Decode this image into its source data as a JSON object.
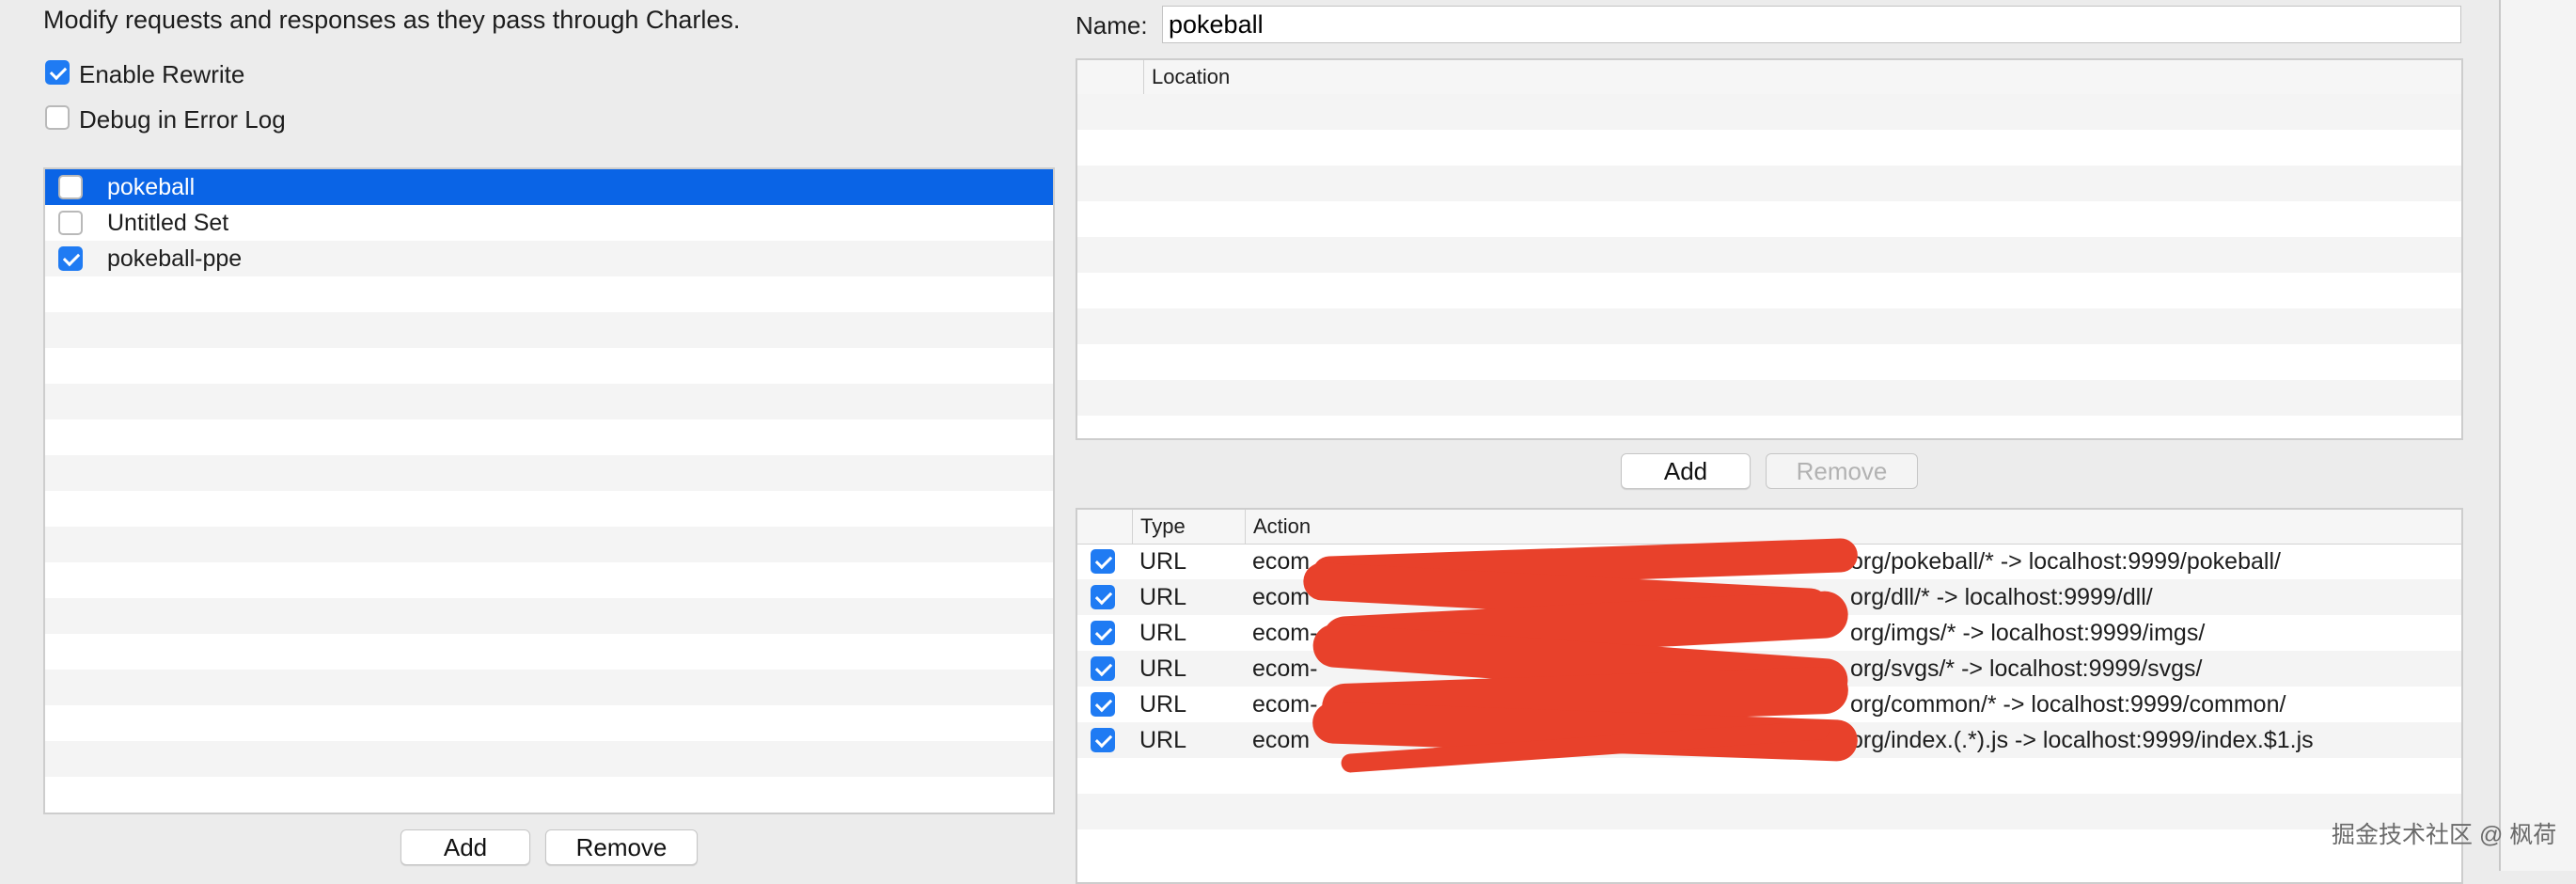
{
  "description": "Modify requests and responses as they pass through Charles.",
  "options": {
    "enable_rewrite": {
      "label": "Enable Rewrite",
      "checked": true
    },
    "debug_error_log": {
      "label": "Debug in Error Log",
      "checked": false
    }
  },
  "sets": [
    {
      "name": "pokeball",
      "checked": false,
      "selected": true
    },
    {
      "name": "Untitled Set",
      "checked": false,
      "selected": false
    },
    {
      "name": "pokeball-ppe",
      "checked": true,
      "selected": false
    }
  ],
  "left_buttons": {
    "add": "Add",
    "remove": "Remove"
  },
  "name_field": {
    "label": "Name:",
    "value": "pokeball"
  },
  "location_table": {
    "header": "Location"
  },
  "location_buttons": {
    "add": "Add",
    "remove": "Remove"
  },
  "rules_table": {
    "headers": {
      "type": "Type",
      "action": "Action"
    },
    "rows": [
      {
        "checked": true,
        "type": "URL",
        "action_prefix": "ecom",
        "action_suffix": "org/pokeball/* -> localhost:9999/pokeball/"
      },
      {
        "checked": true,
        "type": "URL",
        "action_prefix": "ecom",
        "action_suffix": "org/dll/* -> localhost:9999/dll/"
      },
      {
        "checked": true,
        "type": "URL",
        "action_prefix": "ecom-",
        "action_suffix": "org/imgs/* -> localhost:9999/imgs/"
      },
      {
        "checked": true,
        "type": "URL",
        "action_prefix": "ecom-",
        "action_suffix": "org/svgs/* -> localhost:9999/svgs/"
      },
      {
        "checked": true,
        "type": "URL",
        "action_prefix": "ecom-",
        "action_suffix": "org/common/* -> localhost:9999/common/"
      },
      {
        "checked": true,
        "type": "URL",
        "action_prefix": "ecom",
        "action_suffix": "org/index.(.*).js -> localhost:9999/index.$1.js"
      }
    ]
  },
  "watermark": "掘金技术社区 @ 枫荷",
  "colors": {
    "accent": "#1f7bf3",
    "selection": "#0a64e6",
    "redaction": "#e8412b"
  }
}
